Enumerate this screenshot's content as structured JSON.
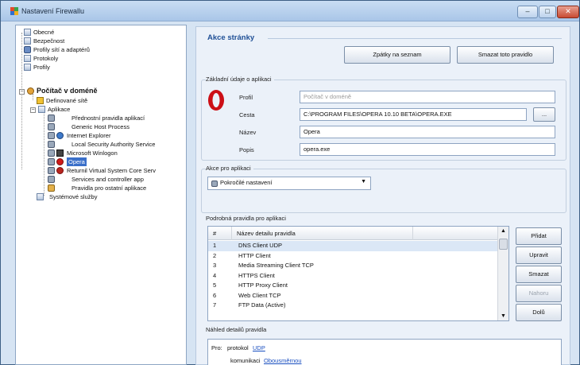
{
  "window": {
    "title": "Nastavení Firewallu"
  },
  "titlebar_controls": {
    "minimize": "–",
    "maximize": "□",
    "close": "✕"
  },
  "tree": {
    "items": [
      {
        "label": "Obecné",
        "icon": "document-icon"
      },
      {
        "label": "Bezpečnost",
        "icon": "document-icon"
      },
      {
        "label": "Profily sítí a adaptérů",
        "icon": "network-icon"
      },
      {
        "label": "Protokoly",
        "icon": "document-icon"
      },
      {
        "label": "Profily",
        "icon": "document-icon"
      },
      {
        "label": "Počítač v doméně",
        "icon": "user-icon"
      },
      {
        "label": "Definované sítě",
        "icon": "warning-icon"
      },
      {
        "label": "Aplikace",
        "icon": "document-icon"
      },
      {
        "label": "Přednostní pravidla aplikací",
        "icon": "gear-icon"
      },
      {
        "label": "Generic Host Process",
        "icon": "gear-icon"
      },
      {
        "label": "Internet Explorer",
        "icon": "internet-explorer-icon"
      },
      {
        "label": "Local Security Authority Service",
        "icon": "gear-icon"
      },
      {
        "label": "Microsoft Winlogon",
        "icon": "gear-icon"
      },
      {
        "label": "Opera",
        "icon": "opera-icon"
      },
      {
        "label": "Returnil Virtual System Core Serv",
        "icon": "gear-icon"
      },
      {
        "label": "Services and controller app",
        "icon": "gear-icon"
      },
      {
        "label": "Pravidla pro ostatní aplikace",
        "icon": "gear-icon"
      },
      {
        "label": "Systémové služby",
        "icon": "document-icon"
      }
    ],
    "expand_collapse_glyph": "−"
  },
  "main": {
    "page_title": "Akce stránky",
    "back_button": "Zpátky na seznam",
    "delete_button": "Smazat toto pravidlo",
    "basic_info": {
      "legend": "Základní údaje o aplikaci",
      "profile_label": "Profil",
      "profile_value": "Počítač v doméně",
      "path_label": "Cesta",
      "path_value": "C:\\PROGRAM FILES\\OPERA 10.10 BETA\\OPERA.EXE",
      "browse_button": "...",
      "name_label": "Název",
      "name_value": "Opera",
      "desc_label": "Popis",
      "desc_value": "opera.exe"
    },
    "app_action": {
      "legend": "Akce pro aplikaci",
      "selected": "Pokročilé nastavení",
      "arrow": "▼"
    },
    "rules": {
      "legend": "Podrobná pravidla pro aplikaci",
      "col_num": "#",
      "col_name": "Název detailu pravidla",
      "scroll_up": "▲",
      "scroll_down": "▼",
      "rows": [
        {
          "num": "1",
          "name": "DNS Client UDP"
        },
        {
          "num": "2",
          "name": "HTTP Client"
        },
        {
          "num": "3",
          "name": "Media Streaming Client TCP"
        },
        {
          "num": "4",
          "name": "HTTPS Client"
        },
        {
          "num": "5",
          "name": "HTTP Proxy Client"
        },
        {
          "num": "6",
          "name": "Web Client TCP"
        },
        {
          "num": "7",
          "name": "FTP Data (Active)"
        }
      ],
      "buttons": {
        "add": "Přidat",
        "edit": "Upravit",
        "delete": "Smazat",
        "up": "Nahoru",
        "down": "Dolů"
      }
    },
    "preview": {
      "legend": "Náhled detailů pravidla",
      "for_label": "Pro:",
      "protocol_label": "protokol",
      "protocol_value": "UDP",
      "comm_label": "komunikaci",
      "comm_value": "Obousměrnou"
    }
  }
}
